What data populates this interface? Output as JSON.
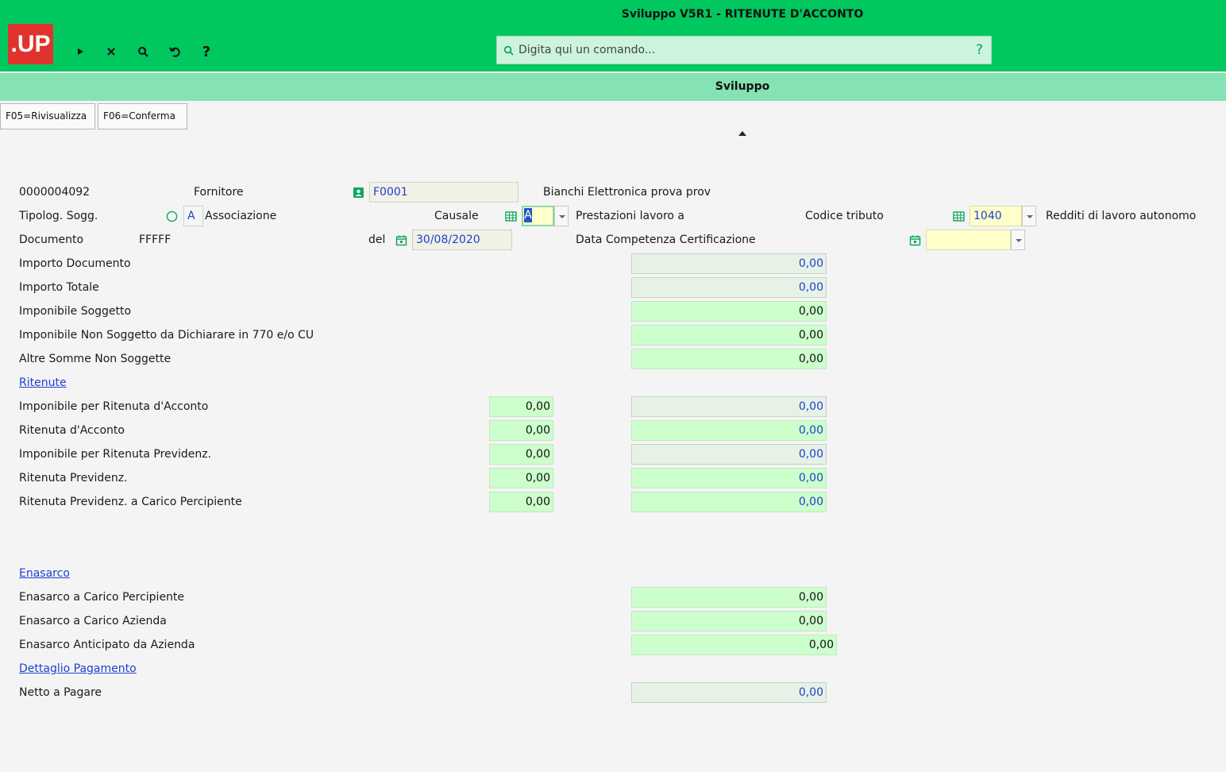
{
  "app": {
    "logo_text": ".UP",
    "window_title": "Sviluppo V5R1 - RITENUTE D'ACCONTO",
    "command_placeholder": "Digita qui un comando...",
    "command_help": "?",
    "section_title": "Sviluppo",
    "accent_color": "#00c75e"
  },
  "toolbar": {
    "run": "▸",
    "close": "✕",
    "search": "⚲",
    "undo": "↺",
    "help": "?"
  },
  "function_keys": {
    "f05": "F05=Rivisualizza",
    "f06": "F06=Conferma"
  },
  "header": {
    "doc_id": "0000004092",
    "fornitore_label": "Fornitore",
    "fornitore_code": "F0001",
    "fornitore_name": "Bianchi Elettronica prova prov",
    "tipolog_label": "Tipolog. Sogg.",
    "tipolog_code": "A",
    "tipolog_desc": "Associazione",
    "causale_label": "Causale",
    "causale_code": "A",
    "causale_desc": "Prestazioni lavoro a",
    "codice_tributo_label": "Codice tributo",
    "codice_tributo_code": "1040",
    "codice_tributo_desc": "Redditi di lavoro autonomo",
    "documento_label": "Documento",
    "documento_value": "FFFFF",
    "del_label": "del",
    "del_date": "30/08/2020",
    "data_competenza_label": "Data Competenza Certificazione",
    "data_competenza_value": ""
  },
  "amounts": {
    "importo_documento": {
      "label": "Importo Documento",
      "value": "0,00"
    },
    "importo_totale": {
      "label": "Importo Totale",
      "value": "0,00"
    },
    "imponibile_soggetto": {
      "label": "Imponibile Soggetto",
      "value": "0,00"
    },
    "imponibile_non_soggetto": {
      "label": "Imponibile Non Soggetto da Dichiarare in 770 e/o CU",
      "value": "0,00"
    },
    "altre_somme": {
      "label": "Altre Somme Non Soggette",
      "value": "0,00"
    }
  },
  "ritenute": {
    "section_label": "Ritenute",
    "rows": [
      {
        "label": "Imponibile per Ritenuta d'Acconto",
        "value1": "0,00",
        "value2": "0,00"
      },
      {
        "label": "Ritenuta d'Acconto",
        "value1": "0,00",
        "value2": "0,00"
      },
      {
        "label": "Imponibile per Ritenuta Previdenz.",
        "value1": "0,00",
        "value2": "0,00"
      },
      {
        "label": "Ritenuta Previdenz.",
        "value1": "0,00",
        "value2": "0,00"
      },
      {
        "label": "Ritenuta Previdenz. a Carico Percipiente",
        "value1": "0,00",
        "value2": "0,00"
      }
    ]
  },
  "enasarco": {
    "section_label": "Enasarco",
    "rows": [
      {
        "label": "Enasarco a Carico Percipiente",
        "value": "0,00"
      },
      {
        "label": "Enasarco a Carico Azienda",
        "value": "0,00"
      },
      {
        "label": "Enasarco Anticipato da Azienda",
        "value": "0,00"
      }
    ]
  },
  "pagamento": {
    "section_label": "Dettaglio Pagamento",
    "netto_label": "Netto a Pagare",
    "netto_value": "0,00"
  }
}
